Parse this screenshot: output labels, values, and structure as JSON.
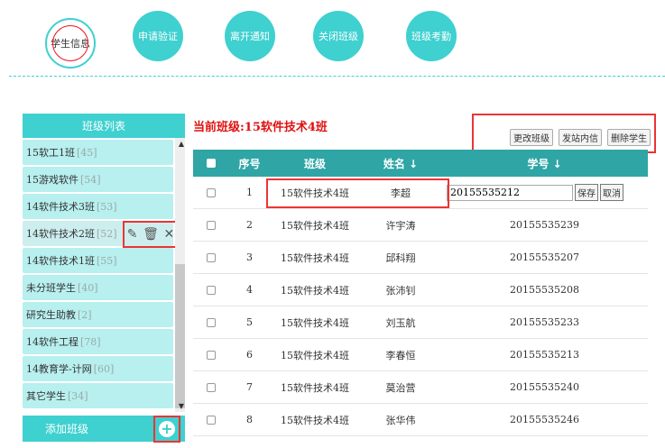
{
  "nav": {
    "items": [
      {
        "label": "学生信息",
        "active": true
      },
      {
        "label": "申请验证",
        "active": false
      },
      {
        "label": "离开通知",
        "active": false
      },
      {
        "label": "关闭班级",
        "active": false
      },
      {
        "label": "班级考勤",
        "active": false
      }
    ]
  },
  "sidebar": {
    "title": "班级列表",
    "items": [
      {
        "name": "15软工1班",
        "count": "[45]"
      },
      {
        "name": "15游戏软件",
        "count": "[54]"
      },
      {
        "name": "14软件技术3班",
        "count": "[53]"
      },
      {
        "name": "14软件技术2班",
        "count": "[52]"
      },
      {
        "name": "14软件技术1班",
        "count": "[55]"
      },
      {
        "name": "未分班学生",
        "count": "[40]"
      },
      {
        "name": "研究生助教",
        "count": "[2]"
      },
      {
        "name": "14软件工程",
        "count": "[78]"
      },
      {
        "name": "14教育学-计网",
        "count": "[60]"
      },
      {
        "name": "其它学生",
        "count": "[34]"
      }
    ],
    "item_actions": {
      "edit_icon": "✎",
      "delete_icon": "🗑",
      "close_icon": "✕"
    },
    "add_label": "添加班级",
    "add_icon": "+"
  },
  "main": {
    "title": "当前班级:15软件技术4班",
    "toolbar": [
      "更改班级",
      "发站内信",
      "删除学生"
    ],
    "columns": [
      "序号",
      "班级",
      "姓名 ↓",
      "学号 ↓"
    ],
    "edit": {
      "value": "20155535212",
      "save": "保存",
      "cancel": "取消"
    },
    "rows": [
      {
        "idx": "1",
        "class": "15软件技术4班",
        "name": "李超",
        "id": ""
      },
      {
        "idx": "2",
        "class": "15软件技术4班",
        "name": "许宇涛",
        "id": "20155535239"
      },
      {
        "idx": "3",
        "class": "15软件技术4班",
        "name": "邱科翔",
        "id": "20155535207"
      },
      {
        "idx": "4",
        "class": "15软件技术4班",
        "name": "张沛钊",
        "id": "20155535208"
      },
      {
        "idx": "5",
        "class": "15软件技术4班",
        "name": "刘玉航",
        "id": "20155535233"
      },
      {
        "idx": "6",
        "class": "15软件技术4班",
        "name": "李春恒",
        "id": "20155535213"
      },
      {
        "idx": "7",
        "class": "15软件技术4班",
        "name": "莫治营",
        "id": "20155535240"
      },
      {
        "idx": "8",
        "class": "15软件技术4班",
        "name": "张华伟",
        "id": "20155535246"
      }
    ]
  }
}
